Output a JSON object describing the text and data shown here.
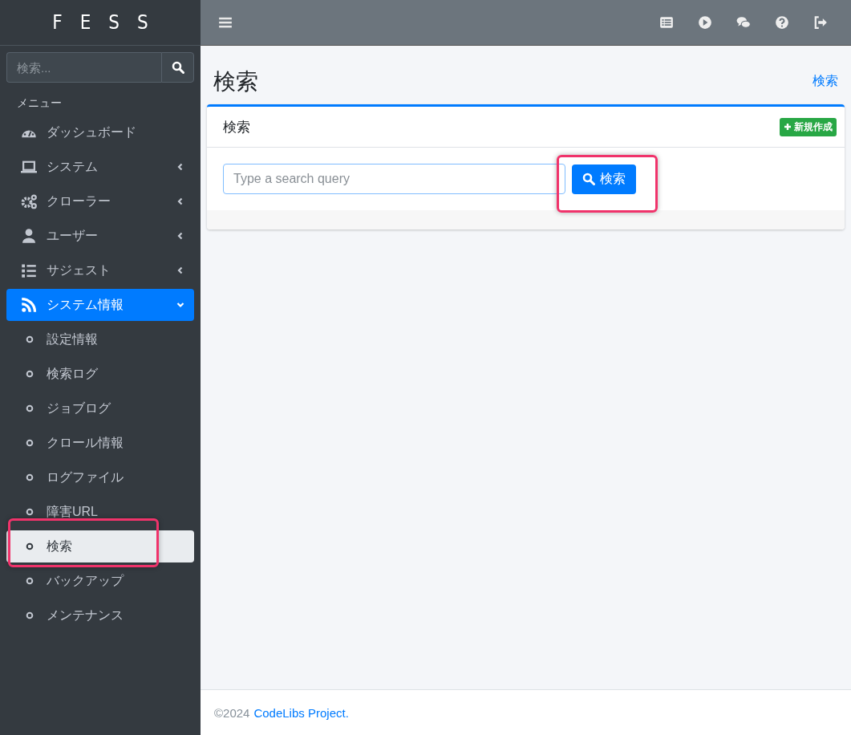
{
  "brand": "FESS",
  "sidebar": {
    "search": {
      "placeholder": "検索..."
    },
    "menu_header": "メニュー",
    "items": [
      {
        "label": "ダッシュボード",
        "kind": "link",
        "selected": false
      },
      {
        "label": "システム",
        "kind": "group",
        "selected": false,
        "expanded": false
      },
      {
        "label": "クローラー",
        "kind": "group",
        "selected": false,
        "expanded": false
      },
      {
        "label": "ユーザー",
        "kind": "group",
        "selected": false,
        "expanded": false
      },
      {
        "label": "サジェスト",
        "kind": "group",
        "selected": false,
        "expanded": false
      },
      {
        "label": "システム情報",
        "kind": "group",
        "selected": true,
        "expanded": true,
        "children": [
          {
            "label": "設定情報",
            "selected": false,
            "highlighted": false
          },
          {
            "label": "検索ログ",
            "selected": false,
            "highlighted": false
          },
          {
            "label": "ジョブログ",
            "selected": false,
            "highlighted": false
          },
          {
            "label": "クロール情報",
            "selected": false,
            "highlighted": false
          },
          {
            "label": "ログファイル",
            "selected": false,
            "highlighted": false
          },
          {
            "label": "障害URL",
            "selected": false,
            "highlighted": false
          },
          {
            "label": "検索",
            "selected": true,
            "highlighted": true
          },
          {
            "label": "バックアップ",
            "selected": false,
            "highlighted": false
          },
          {
            "label": "メンテナンス",
            "selected": false,
            "highlighted": false
          }
        ]
      }
    ]
  },
  "page": {
    "title": "検索",
    "breadcrumb": "検索"
  },
  "card": {
    "title": "検索",
    "new_button": "新規作成",
    "query_field": {
      "placeholder": "Type a search query"
    },
    "search_button": {
      "label": "検索",
      "highlighted": true
    }
  },
  "footer": {
    "copyright": "©2024",
    "link": "CodeLibs Project."
  }
}
